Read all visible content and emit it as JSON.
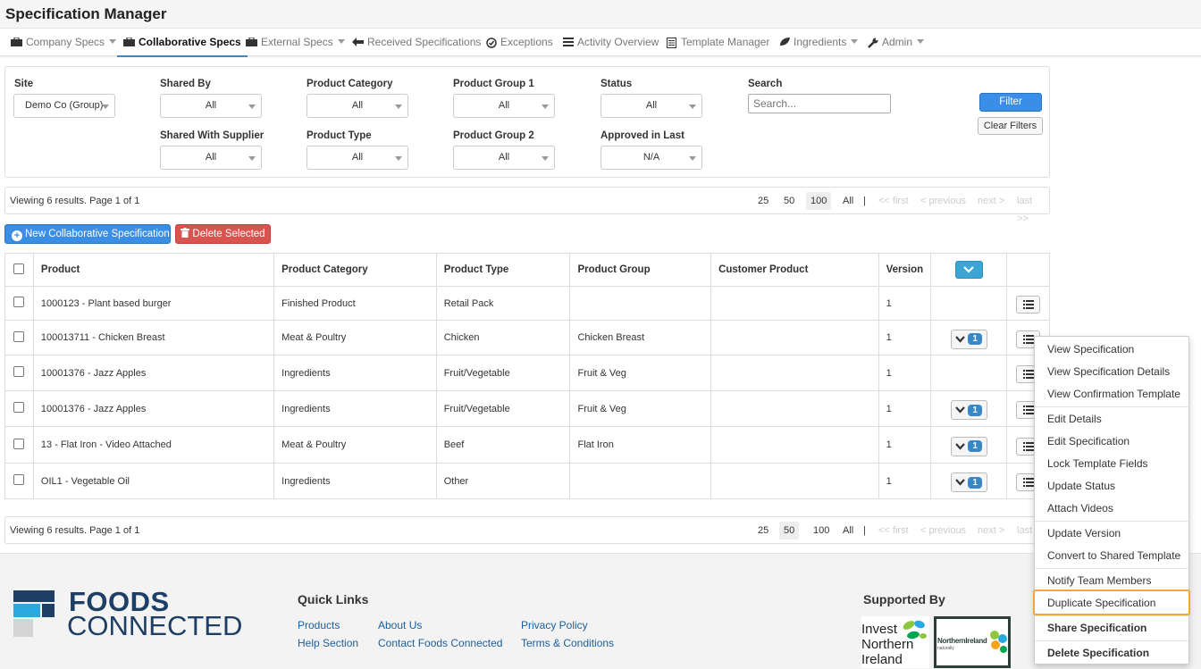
{
  "app": {
    "title": "Specification Manager"
  },
  "nav": [
    {
      "label": "Company Specs",
      "icon": "briefcase-icon",
      "has_caret": true
    },
    {
      "label": "Collaborative Specs",
      "icon": "briefcase-icon",
      "active": true
    },
    {
      "label": "External Specs",
      "icon": "briefcase-icon",
      "has_caret": true
    },
    {
      "label": "Received Specifications",
      "icon": "arrow-left-icon"
    },
    {
      "label": "Exceptions",
      "icon": "check-circle-icon"
    },
    {
      "label": "Activity Overview",
      "icon": "list-icon"
    },
    {
      "label": "Template Manager",
      "icon": "template-icon"
    },
    {
      "label": "Ingredients",
      "icon": "leaf-icon",
      "has_caret": true
    },
    {
      "label": "Admin",
      "icon": "wrench-icon",
      "has_caret": true
    }
  ],
  "filters": {
    "site": {
      "label": "Site",
      "value": "Demo Co (Group)"
    },
    "shared_by": {
      "label": "Shared By",
      "value": "All"
    },
    "product_category": {
      "label": "Product Category",
      "value": "All"
    },
    "product_group_1": {
      "label": "Product Group 1",
      "value": "All"
    },
    "status": {
      "label": "Status",
      "value": "All"
    },
    "search": {
      "label": "Search",
      "placeholder": "Search..."
    },
    "shared_with_supplier": {
      "label": "Shared With Supplier",
      "value": "All"
    },
    "product_type": {
      "label": "Product Type",
      "value": "All"
    },
    "product_group_2": {
      "label": "Product Group 2",
      "value": "All"
    },
    "approved_in_last": {
      "label": "Approved in Last",
      "value": "N/A"
    },
    "filter_button": "Filter",
    "clear_button": "Clear Filters"
  },
  "pager": {
    "summary": "Viewing 6 results. Page 1 of 1",
    "sizes": [
      "25",
      "50",
      "100",
      "All"
    ],
    "sep": "|",
    "first": "<< first",
    "previous": "< previous",
    "next": "next >",
    "last": "last >>"
  },
  "pager_bottom": {
    "last": "last"
  },
  "actions": {
    "new_label": "New Collaborative Specification",
    "delete_label": "Delete Selected"
  },
  "table": {
    "headers": [
      "Product",
      "Product Category",
      "Product Type",
      "Product Group",
      "Customer Product",
      "Version"
    ],
    "rows": [
      {
        "product": "1000123 - Plant based burger",
        "category": "Finished Product",
        "type": "Retail Pack",
        "group": "",
        "customer": "",
        "version": "1",
        "count": ""
      },
      {
        "product": "100013711 - Chicken Breast",
        "category": "Meat & Poultry",
        "type": "Chicken",
        "group": "Chicken Breast",
        "customer": "",
        "version": "1",
        "count": "1"
      },
      {
        "product": "10001376 - Jazz Apples",
        "category": "Ingredients",
        "type": "Fruit/Vegetable",
        "group": "Fruit & Veg",
        "customer": "",
        "version": "1",
        "count": ""
      },
      {
        "product": "10001376 - Jazz Apples",
        "category": "Ingredients",
        "type": "Fruit/Vegetable",
        "group": "Fruit & Veg",
        "customer": "",
        "version": "1",
        "count": "1"
      },
      {
        "product": "13 - Flat Iron - Video Attached",
        "category": "Meat & Poultry",
        "type": "Beef",
        "group": "Flat Iron",
        "customer": "",
        "version": "1",
        "count": "1"
      },
      {
        "product": "OIL1 - Vegetable Oil",
        "category": "Ingredients",
        "type": "Other",
        "group": "",
        "customer": "",
        "version": "1",
        "count": "1"
      }
    ]
  },
  "context_menu": {
    "items": [
      "View Specification",
      "View Specification Details",
      "View Confirmation Template",
      "Edit Details",
      "Edit Specification",
      "Lock Template Fields",
      "Update Status",
      "Attach Videos",
      "Update Version",
      "Convert to Shared Template",
      "Notify Team Members",
      "Duplicate Specification",
      "Share Specification",
      "Delete Specification"
    ]
  },
  "footer": {
    "brand_line1": "FOODS",
    "brand_line2": "CONNECTED",
    "quick_links_title": "Quick Links",
    "links": [
      "Products",
      "About Us",
      "Privacy Policy",
      "Help Section",
      "Contact Foods Connected",
      "Terms & Conditions"
    ],
    "supported_by_title": "Supported By",
    "invest_logo": [
      "Invest",
      "Northern",
      "Ireland"
    ],
    "ni_logo": [
      "NorthernIreland",
      "naturally"
    ]
  },
  "colors": {
    "accent": "#3a8ee6",
    "danger": "#d9534f",
    "highlight": "#f0a733",
    "brand_dark": "#1d3f66",
    "brand_light": "#2aa8e0"
  }
}
